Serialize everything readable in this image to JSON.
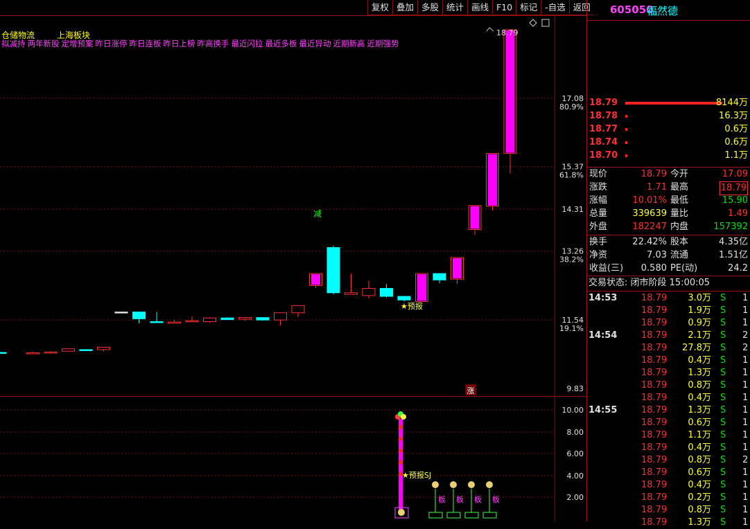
{
  "toolbar": [
    "复权",
    "叠加",
    "多股",
    "统计",
    "画线",
    "F10",
    "标记",
    "-自选",
    "返回"
  ],
  "chart": {
    "title_left": "仓储物流",
    "title_right": "上海板块",
    "indicators": [
      "拟减持",
      "两年新股",
      "定增预案",
      "昨日涨停",
      "昨日连板",
      "昨日上榜",
      "昨高换手",
      "最近闪拉",
      "最近多板",
      "最近异动",
      "近期新高",
      "近期强势"
    ],
    "price_axis": [
      "17.08",
      "80.9%",
      "15.37",
      "61.8%",
      "14.31",
      "13.26",
      "38.2%",
      "11.54",
      "19.1%",
      "9.83"
    ],
    "high_marker": "18.79",
    "annotation_reduce": "减",
    "annotation_forecast": "★预报",
    "badge_limit": "涨",
    "lower_axis": [
      "10.00",
      "8.00",
      "6.00",
      "4.00",
      "2.00"
    ],
    "lower_forecast": "★预报SJ",
    "board_label": "板",
    "colors": {
      "up": "#ff00ff",
      "down": "#00ffff",
      "small_up": "#ff3030",
      "grid": "#7a1010"
    }
  },
  "chart_data": {
    "type": "candlestick",
    "candles": [
      {
        "o": 10.73,
        "c": 10.73,
        "h": 10.73,
        "l": 10.73,
        "dir": "down"
      },
      {
        "o": 10.7,
        "c": 10.72,
        "h": 10.74,
        "l": 10.69,
        "dir": "up"
      },
      {
        "o": 10.72,
        "c": 10.74,
        "h": 10.76,
        "l": 10.7,
        "dir": "up"
      },
      {
        "o": 10.76,
        "c": 10.82,
        "h": 10.83,
        "l": 10.76,
        "dir": "up"
      },
      {
        "o": 10.8,
        "c": 10.78,
        "h": 10.81,
        "l": 10.77,
        "dir": "down"
      },
      {
        "o": 10.8,
        "c": 10.86,
        "h": 10.87,
        "l": 10.76,
        "dir": "up"
      },
      {
        "o": 11.74,
        "c": 11.74,
        "h": 11.74,
        "l": 11.74,
        "dir": "flat"
      },
      {
        "o": 11.74,
        "c": 11.57,
        "h": 11.74,
        "l": 11.46,
        "dir": "down"
      },
      {
        "o": 11.5,
        "c": 11.48,
        "h": 11.74,
        "l": 11.48,
        "dir": "down"
      },
      {
        "o": 11.46,
        "c": 11.49,
        "h": 11.55,
        "l": 11.46,
        "dir": "up"
      },
      {
        "o": 11.5,
        "c": 11.52,
        "h": 11.63,
        "l": 11.49,
        "dir": "up"
      },
      {
        "o": 11.5,
        "c": 11.59,
        "h": 11.61,
        "l": 11.47,
        "dir": "up"
      },
      {
        "o": 11.59,
        "c": 11.55,
        "h": 11.61,
        "l": 11.54,
        "dir": "down"
      },
      {
        "o": 11.56,
        "c": 11.6,
        "h": 11.61,
        "l": 11.52,
        "dir": "up"
      },
      {
        "o": 11.6,
        "c": 11.54,
        "h": 11.61,
        "l": 11.52,
        "dir": "down"
      },
      {
        "o": 11.54,
        "c": 11.72,
        "h": 11.72,
        "l": 11.4,
        "dir": "up"
      },
      {
        "o": 11.72,
        "c": 11.9,
        "h": 11.9,
        "l": 11.61,
        "dir": "up"
      },
      {
        "o": 12.4,
        "c": 12.7,
        "h": 12.7,
        "l": 12.34,
        "dir": "up_fill"
      },
      {
        "o": 13.35,
        "c": 12.22,
        "h": 13.4,
        "l": 12.18,
        "dir": "down"
      },
      {
        "o": 12.22,
        "c": 12.18,
        "h": 12.7,
        "l": 12.18,
        "dir": "up"
      },
      {
        "o": 12.15,
        "c": 12.33,
        "h": 12.52,
        "l": 12.08,
        "dir": "up"
      },
      {
        "o": 12.33,
        "c": 12.13,
        "h": 12.44,
        "l": 12.1,
        "dir": "down"
      },
      {
        "o": 12.13,
        "c": 12.04,
        "h": 12.14,
        "l": 12.0,
        "dir": "down"
      },
      {
        "o": 12.0,
        "c": 12.7,
        "h": 12.7,
        "l": 12.0,
        "dir": "up_fill"
      },
      {
        "o": 12.7,
        "c": 12.54,
        "h": 12.7,
        "l": 12.46,
        "dir": "down"
      },
      {
        "o": 12.56,
        "c": 13.1,
        "h": 13.1,
        "l": 12.44,
        "dir": "up_fill"
      },
      {
        "o": 13.8,
        "c": 14.4,
        "h": 14.4,
        "l": 13.67,
        "dir": "up_fill"
      },
      {
        "o": 14.38,
        "c": 15.7,
        "h": 15.7,
        "l": 14.27,
        "dir": "up_fill"
      },
      {
        "o": 15.7,
        "c": 18.79,
        "h": 18.79,
        "l": 15.2,
        "dir": "up_fill"
      }
    ],
    "price_range": [
      9.83,
      18.79
    ]
  },
  "quote": {
    "code": "605050",
    "name": "福然德",
    "order_book": [
      {
        "price": "18.79",
        "vol": "8144万",
        "bar": 1.0
      },
      {
        "price": "18.78",
        "vol": "16.3万",
        "bar": 0.01
      },
      {
        "price": "18.77",
        "vol": "0.6万",
        "bar": 0.01
      },
      {
        "price": "18.74",
        "vol": "0.6万",
        "bar": 0.01
      },
      {
        "price": "18.70",
        "vol": "1.1万",
        "bar": 0.01
      }
    ],
    "stats": [
      [
        "现价",
        "18.79",
        "今开",
        "17.09"
      ],
      [
        "涨跌",
        "1.71",
        "最高",
        "18.79"
      ],
      [
        "涨幅",
        "10.01%",
        "最低",
        "15.90"
      ],
      [
        "总量",
        "339639",
        "量比",
        "1.49"
      ],
      [
        "外盘",
        "182247",
        "内盘",
        "157392"
      ]
    ],
    "stats2": [
      [
        "换手",
        "22.42%",
        "股本",
        "4.35亿"
      ],
      [
        "净资",
        "7.03",
        "流通",
        "1.51亿"
      ],
      [
        "收益(三)",
        "0.580",
        "PE(动)",
        "24.2"
      ]
    ],
    "trade_status": "交易状态: 闭市阶段 15:00:05",
    "ticks": [
      {
        "time": "14:53",
        "price": "18.79",
        "vol": "3.0万",
        "side": "S",
        "n": "1"
      },
      {
        "time": "",
        "price": "18.79",
        "vol": "1.9万",
        "side": "S",
        "n": "1"
      },
      {
        "time": "",
        "price": "18.79",
        "vol": "0.9万",
        "side": "S",
        "n": "1"
      },
      {
        "time": "14:54",
        "price": "18.79",
        "vol": "2.1万",
        "side": "S",
        "n": "2"
      },
      {
        "time": "",
        "price": "18.79",
        "vol": "27.8万",
        "side": "S",
        "n": "2"
      },
      {
        "time": "",
        "price": "18.79",
        "vol": "0.4万",
        "side": "S",
        "n": "1"
      },
      {
        "time": "",
        "price": "18.79",
        "vol": "1.3万",
        "side": "S",
        "n": "1"
      },
      {
        "time": "",
        "price": "18.79",
        "vol": "0.8万",
        "side": "S",
        "n": "1"
      },
      {
        "time": "",
        "price": "18.79",
        "vol": "0.4万",
        "side": "S",
        "n": "1"
      },
      {
        "time": "14:55",
        "price": "18.79",
        "vol": "1.3万",
        "side": "S",
        "n": "1"
      },
      {
        "time": "",
        "price": "18.79",
        "vol": "0.6万",
        "side": "S",
        "n": "1"
      },
      {
        "time": "",
        "price": "18.79",
        "vol": "1.1万",
        "side": "S",
        "n": "1"
      },
      {
        "time": "",
        "price": "18.79",
        "vol": "0.4万",
        "side": "S",
        "n": "1"
      },
      {
        "time": "",
        "price": "18.79",
        "vol": "0.8万",
        "side": "S",
        "n": "2"
      },
      {
        "time": "",
        "price": "18.79",
        "vol": "0.6万",
        "side": "S",
        "n": "1"
      },
      {
        "time": "",
        "price": "18.79",
        "vol": "0.4万",
        "side": "S",
        "n": "1"
      },
      {
        "time": "",
        "price": "18.79",
        "vol": "0.2万",
        "side": "S",
        "n": "1"
      },
      {
        "time": "",
        "price": "18.79",
        "vol": "0.8万",
        "side": "S",
        "n": "1"
      },
      {
        "time": "",
        "price": "18.79",
        "vol": "1.3万",
        "side": "S",
        "n": "1"
      }
    ]
  }
}
